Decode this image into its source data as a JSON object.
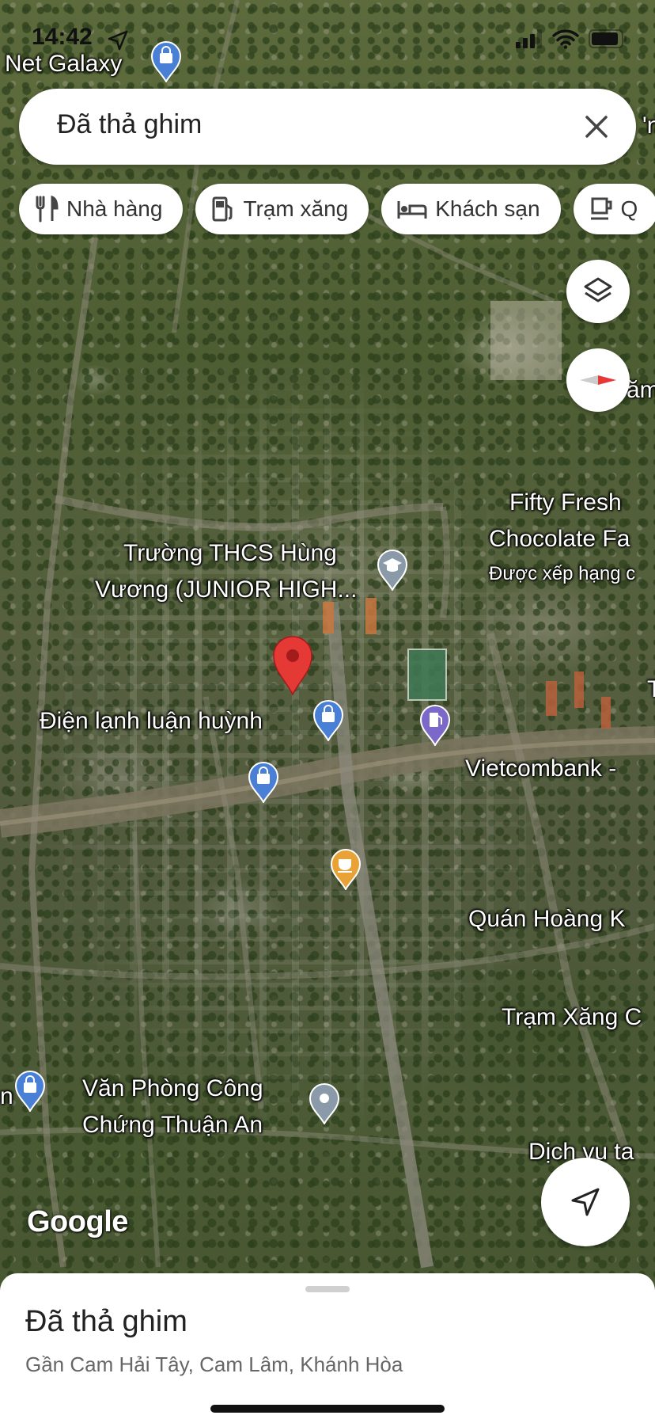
{
  "status_bar": {
    "time": "14:42"
  },
  "search": {
    "value": "Đã thả ghim"
  },
  "chips": [
    {
      "icon": "fork-knife-icon",
      "label": "Nhà hàng"
    },
    {
      "icon": "gas-pump-icon",
      "label": "Trạm xăng"
    },
    {
      "icon": "bed-icon",
      "label": "Khách sạn"
    },
    {
      "icon": "coffee-cup-icon",
      "label": "Q"
    }
  ],
  "map": {
    "labels": {
      "net_galaxy": "Net Galaxy",
      "school_line1": "Trường THCS Hùng",
      "school_line2": "Vương (JUNIOR HIGH...",
      "fifty_line1": "Fifty Fresh",
      "fifty_line2": "Chocolate Fa",
      "fifty_rating": "Được xếp hạng c",
      "dien_lanh": "Điện lạnh luận huỳnh",
      "vietcombank": "Vietcombank -",
      "quan_hoang": "Quán Hoàng K",
      "tram_xang": "Trạm Xăng C",
      "van_phong_line1": "Văn Phòng Công",
      "van_phong_line2": "Chứng Thuận An",
      "dich_vu": "Dịch vụ ta",
      "edge_am": "ăm",
      "edge_t": "T",
      "edge_n": "n",
      "edge_top_right": "'n"
    },
    "attribution": "Google",
    "colors": {
      "pin_red": "#e53935",
      "poi_blue": "#4a7fd6",
      "poi_purple": "#7b68c8",
      "poi_orange": "#e9a235",
      "poi_gray": "#8a9aa8"
    }
  },
  "bottom_sheet": {
    "title": "Đã thả ghim",
    "subtitle": "Gần Cam Hải Tây, Cam Lâm, Khánh Hòa"
  }
}
